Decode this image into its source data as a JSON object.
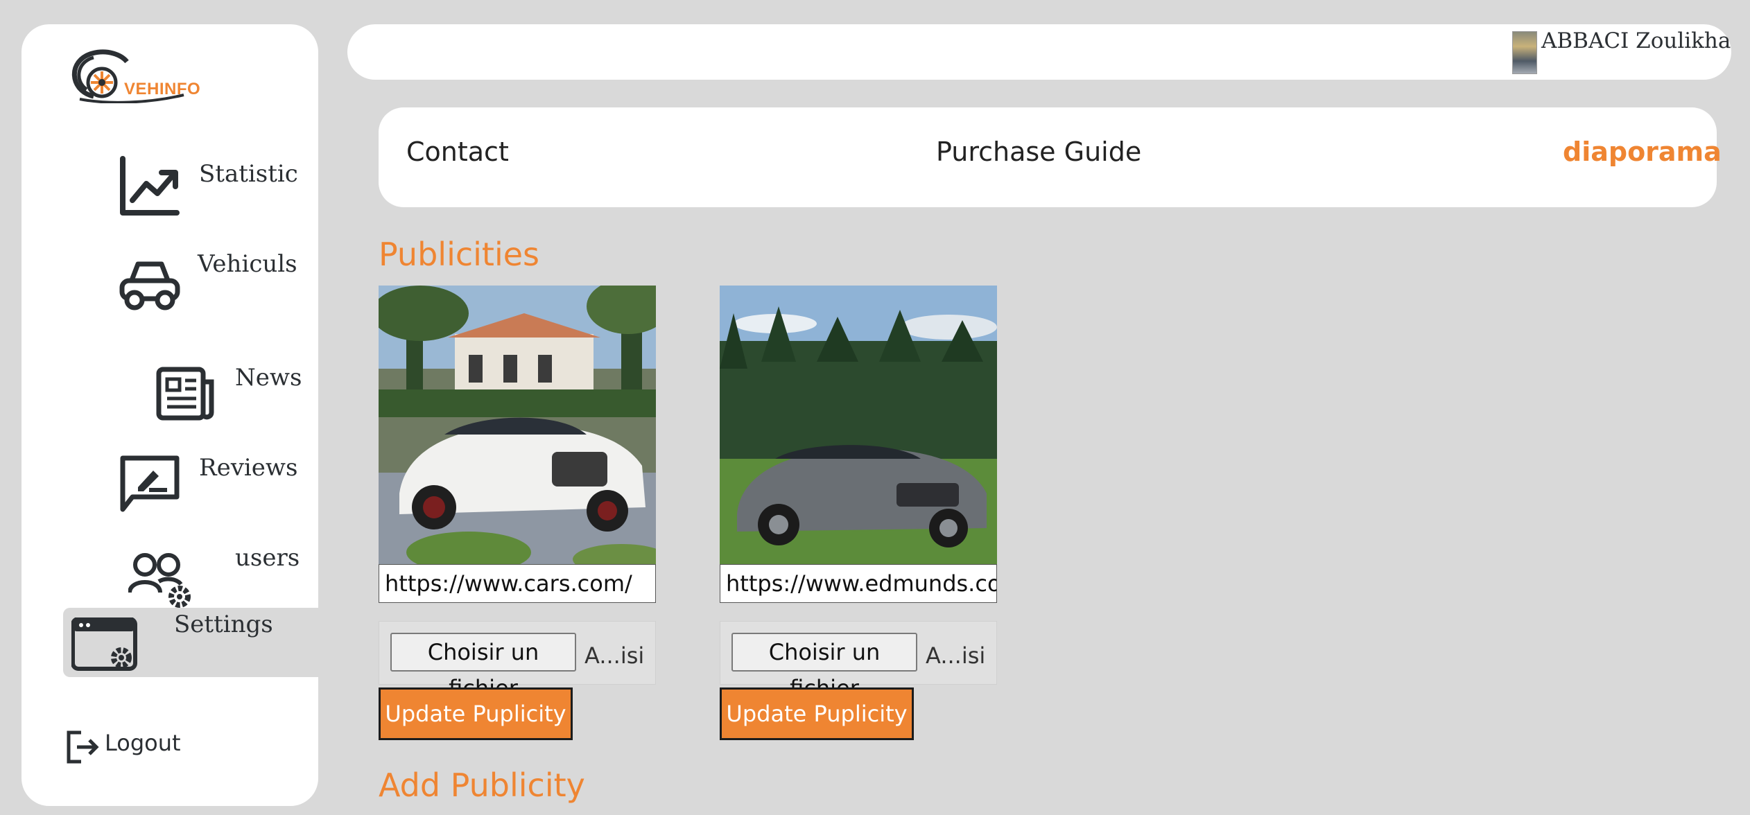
{
  "brand": {
    "name": "VEHINFO",
    "accent": "#ef8532"
  },
  "sidebar": {
    "items": [
      {
        "label": "Statistic",
        "icon": "chart-line-icon"
      },
      {
        "label": "Vehiculs",
        "icon": "car-icon"
      },
      {
        "label": "News",
        "icon": "newspaper-icon"
      },
      {
        "label": "Reviews",
        "icon": "review-edit-icon"
      },
      {
        "label": "users",
        "icon": "users-settings-icon"
      },
      {
        "label": "Settings",
        "icon": "browser-settings-icon",
        "active": true
      }
    ],
    "logout": {
      "label": "Logout",
      "icon": "logout-icon"
    }
  },
  "header": {
    "username": "ABBACI Zoulikha"
  },
  "tabs": [
    {
      "label": "Contact"
    },
    {
      "label": "Purchase Guide"
    },
    {
      "label": "diaporama",
      "active": true
    }
  ],
  "main": {
    "publicities_title": "Publicities",
    "add_title": "Add Publicity",
    "ads": [
      {
        "url": "https://www.cars.com/",
        "file_button": "Choisir un fichier",
        "file_name": "A...isi",
        "update_label": "Update Puplicity"
      },
      {
        "url": "https://www.edmunds.com/",
        "file_button": "Choisir un fichier",
        "file_name": "A...isi",
        "update_label": "Update Puplicity"
      }
    ]
  }
}
